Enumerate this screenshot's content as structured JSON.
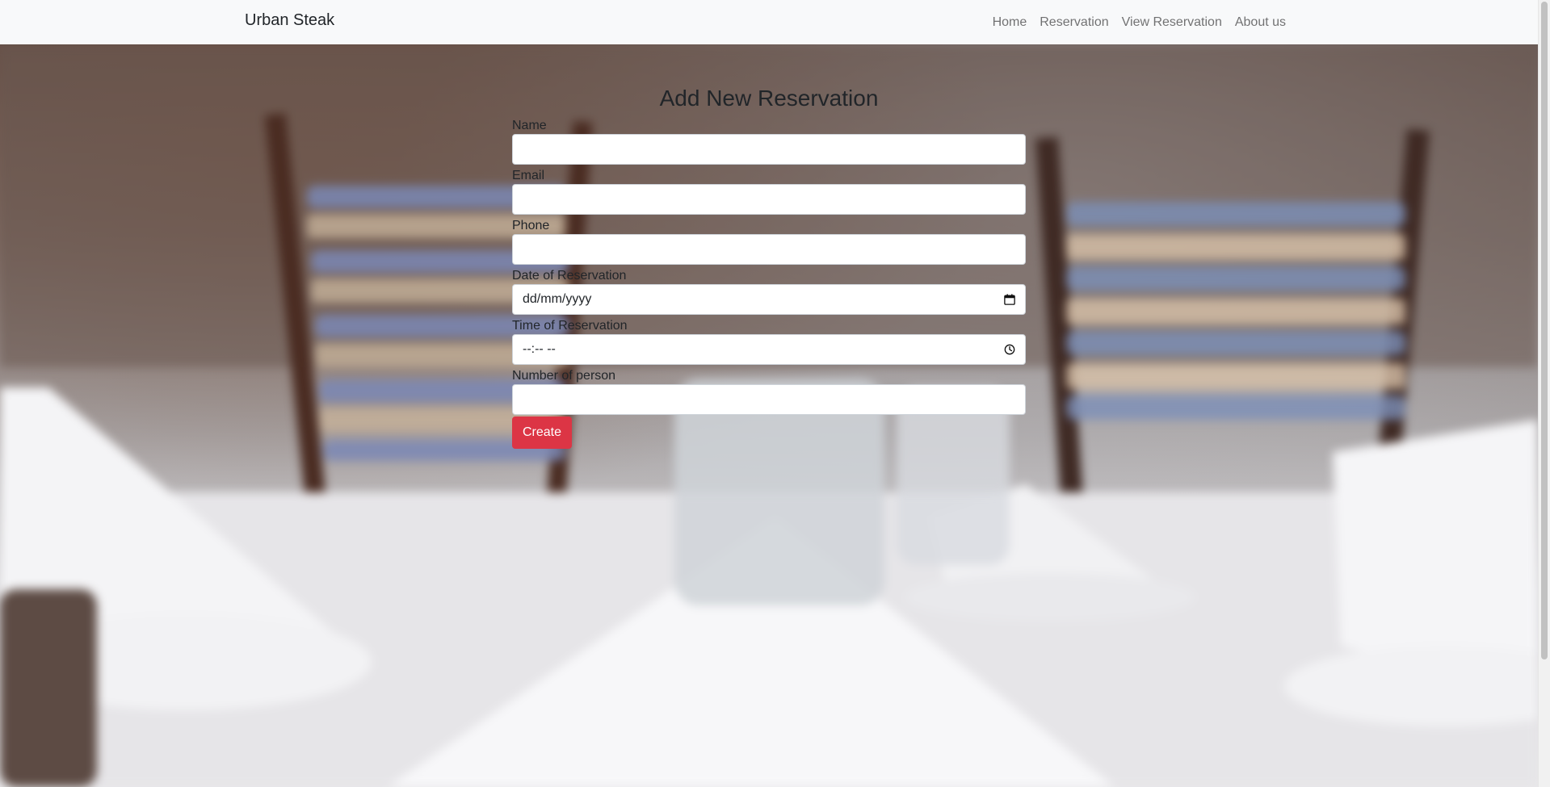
{
  "navbar": {
    "brand": "Urban Steak",
    "links": [
      "Home",
      "Reservation",
      "View Reservation",
      "About us"
    ]
  },
  "form": {
    "title": "Add New Reservation",
    "fields": {
      "name": {
        "label": "Name",
        "value": ""
      },
      "email": {
        "label": "Email",
        "value": ""
      },
      "phone": {
        "label": "Phone",
        "value": ""
      },
      "date": {
        "label": "Date of Reservation",
        "placeholder": "dd/mm/yyyy",
        "icon": "calendar-icon"
      },
      "time": {
        "label": "Time of Reservation",
        "placeholder": "--:-- --",
        "icon": "clock-icon"
      },
      "persons": {
        "label": "Number of person",
        "value": ""
      }
    },
    "submit_label": "Create"
  },
  "colors": {
    "navbar_bg": "#f8f9fa",
    "button_danger": "#dc3545",
    "text": "#212529"
  }
}
